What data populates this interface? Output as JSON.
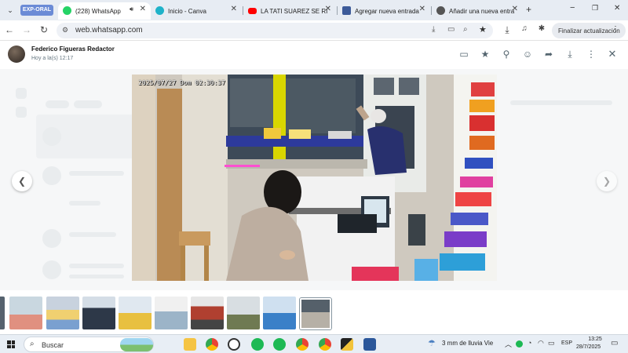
{
  "browser": {
    "profile_badge": "EXP-ORAL",
    "tabs": [
      {
        "title": "(228) WhatsApp",
        "active": true
      },
      {
        "title": "Inicio - Canva"
      },
      {
        "title": "LA TATI SUAREZ SE RI"
      },
      {
        "title": "Agregar nueva entrada"
      },
      {
        "title": "Añadir una nueva entra"
      }
    ],
    "url": "web.whatsapp.com",
    "update_button": "Finalizar actualización"
  },
  "viewer": {
    "sender_name": "Federico Figueras Redactor",
    "sent_time": "Hoy a la(s) 12:17",
    "camera_timestamp": "2025/07/27 Dom 02:30:37"
  },
  "taskbar": {
    "search_placeholder": "Buscar",
    "weather": "3 mm de lluvia Vie",
    "language": "ESP",
    "time": "13:25",
    "date": "28/7/2025"
  },
  "colors": {
    "accent_blue": "#1a73e8",
    "whatsapp_green": "#25d366",
    "profile_badge": "#6b8bd6"
  }
}
